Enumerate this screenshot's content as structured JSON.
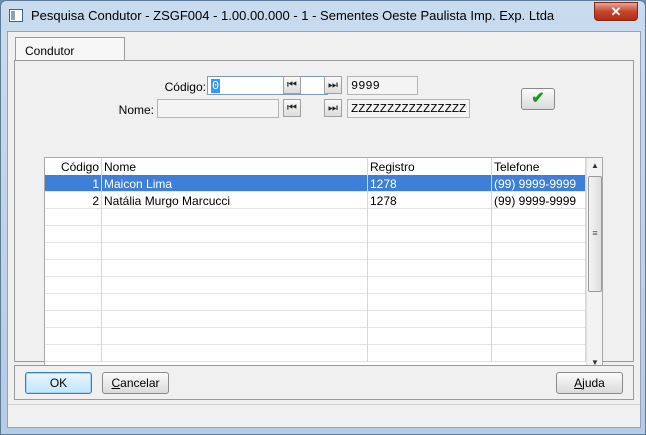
{
  "window": {
    "title": "Pesquisa Condutor - ZSGF004 - 1.00.00.000 - 1 - Sementes Oeste Paulista Imp. Exp. Ltda",
    "close_label": "✕"
  },
  "tab": {
    "label": "Condutor"
  },
  "filters": {
    "codigo_label": "Código:",
    "codigo_from": "0",
    "codigo_to": "9999",
    "nome_label": "Nome:",
    "nome_from": "",
    "nome_to": "ZZZZZZZZZZZZZZZZ",
    "first_glyph": "⏮",
    "last_glyph": "⏭",
    "confirm_glyph": "✔"
  },
  "grid": {
    "columns": [
      "Código",
      "Nome",
      "Registro",
      "Telefone"
    ],
    "rows": [
      {
        "codigo": "1",
        "nome": "Maicon Lima",
        "registro": "1278",
        "telefone": "(99) 9999-9999",
        "selected": true
      },
      {
        "codigo": "2",
        "nome": "Natália Murgo Marcucci",
        "registro": "1278",
        "telefone": "(99) 9999-9999",
        "selected": false
      }
    ],
    "empty_rows": 9
  },
  "buttons": {
    "ok": "OK",
    "cancelar_underlined": "C",
    "cancelar_rest": "ancelar",
    "ajuda_underlined": "A",
    "ajuda_rest": "juda"
  },
  "colors": {
    "selection": "#3d7fd9",
    "confirm_green": "#1a9a1a"
  }
}
